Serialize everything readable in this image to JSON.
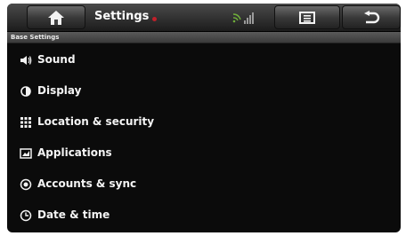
{
  "header": {
    "title": "Settings"
  },
  "subheader": {
    "label": "Base Settings"
  },
  "icons": {
    "home": "home-icon",
    "signal": "signal-icon",
    "menu": "menu-icon",
    "back": "back-icon"
  },
  "menu_items": [
    {
      "label": "Sound",
      "icon": "speaker-icon"
    },
    {
      "label": "Display",
      "icon": "display-icon"
    },
    {
      "label": "Location & security",
      "icon": "grid-icon"
    },
    {
      "label": "Applications",
      "icon": "applications-icon"
    },
    {
      "label": "Accounts & sync",
      "icon": "sync-icon"
    },
    {
      "label": "Date & time",
      "icon": "clock-icon"
    }
  ],
  "colors": {
    "background": "#0b0b0b",
    "accent_red": "#c0202a",
    "signal_green": "#6fae3a"
  }
}
